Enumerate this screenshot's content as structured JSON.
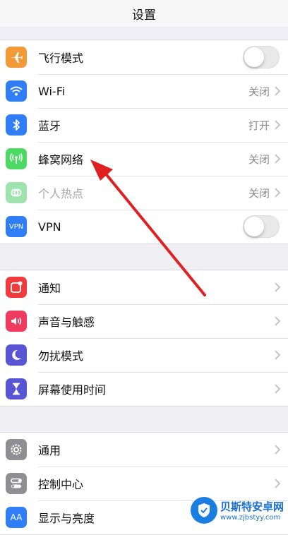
{
  "nav": {
    "title": "设置"
  },
  "colors": {
    "airplane": "#f29a38",
    "wifi": "#2f7ef5",
    "bluetooth": "#2f7ef5",
    "cellular": "#4cd964",
    "hotspot": "#9fe3ae",
    "vpn": "#2f7ef5",
    "notifications": "#ef3b3d",
    "sounds": "#ee3b5f",
    "dnd": "#5956d6",
    "screentime": "#5956d6",
    "general": "#8e8e93",
    "control": "#8e8e93",
    "display": "#2f7ef5",
    "arrow": "#e02020",
    "watermark": "#1a6fd0"
  },
  "group1": [
    {
      "label": "飞行模式",
      "icon": "airplane-icon",
      "control": "toggle",
      "on": false
    },
    {
      "label": "Wi-Fi",
      "icon": "wifi-icon",
      "value": "关闭"
    },
    {
      "label": "蓝牙",
      "icon": "bluetooth-icon",
      "value": "打开"
    },
    {
      "label": "蜂窝网络",
      "icon": "cellular-icon",
      "value": "关闭"
    },
    {
      "label": "个人热点",
      "icon": "hotspot-icon",
      "value": "关闭",
      "disabled": true
    },
    {
      "label": "VPN",
      "icon": "vpn-icon",
      "icon_text": "VPN",
      "control": "toggle",
      "on": false
    }
  ],
  "group2": [
    {
      "label": "通知",
      "icon": "notifications-icon"
    },
    {
      "label": "声音与触感",
      "icon": "sounds-icon"
    },
    {
      "label": "勿扰模式",
      "icon": "moon-icon"
    },
    {
      "label": "屏幕使用时间",
      "icon": "hourglass-icon"
    }
  ],
  "group3": [
    {
      "label": "通用",
      "icon": "gear-icon"
    },
    {
      "label": "控制中心",
      "icon": "control-center-icon"
    },
    {
      "label": "显示与亮度",
      "icon": "display-brightness-icon",
      "icon_text": "AA"
    }
  ],
  "watermark": {
    "title": "贝斯特安卓网",
    "url": "www.zjbstyy.com"
  }
}
